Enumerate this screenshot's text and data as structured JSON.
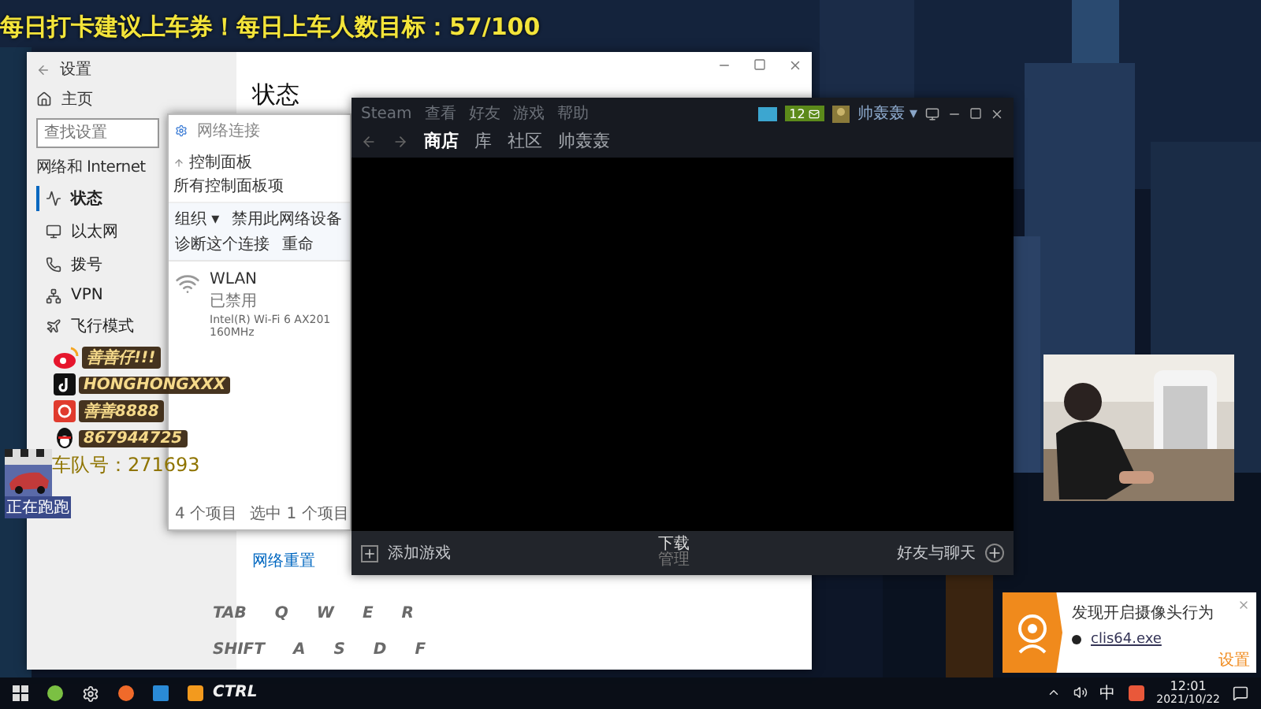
{
  "banner": "每日打卡建议上车券！每日上车人数目标：57/100",
  "settings_window": {
    "title": "设置",
    "home": "主页",
    "search": {
      "placeholder": "查找设置"
    },
    "section": "网络和 Internet",
    "nav": [
      {
        "label": "状态",
        "selected": true
      },
      {
        "label": "以太网",
        "selected": false
      },
      {
        "label": "拨号",
        "selected": false
      },
      {
        "label": "VPN",
        "selected": false
      },
      {
        "label": "飞行模式",
        "selected": false
      }
    ],
    "heading": "状态",
    "link": "网络重置"
  },
  "network_window": {
    "title": "网络连接",
    "breadcrumb": [
      "控制面板",
      "所有控制面板项"
    ],
    "toolbar": [
      "组织 ▾",
      "禁用此网络设备",
      "诊断这个连接",
      "重命"
    ],
    "item": {
      "name": "WLAN",
      "status": "已禁用",
      "adapter": "Intel(R) Wi-Fi 6 AX201 160MHz"
    },
    "status_bar": [
      "4 个项目",
      "选中 1 个项目"
    ]
  },
  "social": [
    {
      "kind": "weibo",
      "handle": "善善仔!!!"
    },
    {
      "kind": "douyin",
      "handle": "HONGHONGXXX"
    },
    {
      "kind": "netease",
      "handle": "善善8888"
    },
    {
      "kind": "qq",
      "handle": "867944725"
    }
  ],
  "team": "车队号：271693",
  "live_badge": "正在跑跑",
  "keys": [
    [
      "TAB",
      "Q",
      "W",
      "E",
      "R"
    ],
    [
      "SHIFT",
      "A",
      "S",
      "D",
      "F"
    ],
    [
      "CTRL"
    ]
  ],
  "steam": {
    "menu": [
      "Steam",
      "查看",
      "好友",
      "游戏",
      "帮助"
    ],
    "nav": [
      {
        "label": "商店",
        "selected": true
      },
      {
        "label": "库",
        "selected": false
      },
      {
        "label": "社区",
        "selected": false
      },
      {
        "label": "帅轰轰",
        "selected": false
      }
    ],
    "badge": "12",
    "user": "帅轰轰 ▾",
    "add_game": "添加游戏",
    "downloads": [
      "下载",
      "管理"
    ],
    "friends": "好友与聊天"
  },
  "notification": {
    "title": "发现开启摄像头行为",
    "process": "clis64.exe",
    "action": "设置"
  },
  "taskbar": {
    "ime": "中",
    "time": "12:01",
    "date": "2021/10/22"
  }
}
